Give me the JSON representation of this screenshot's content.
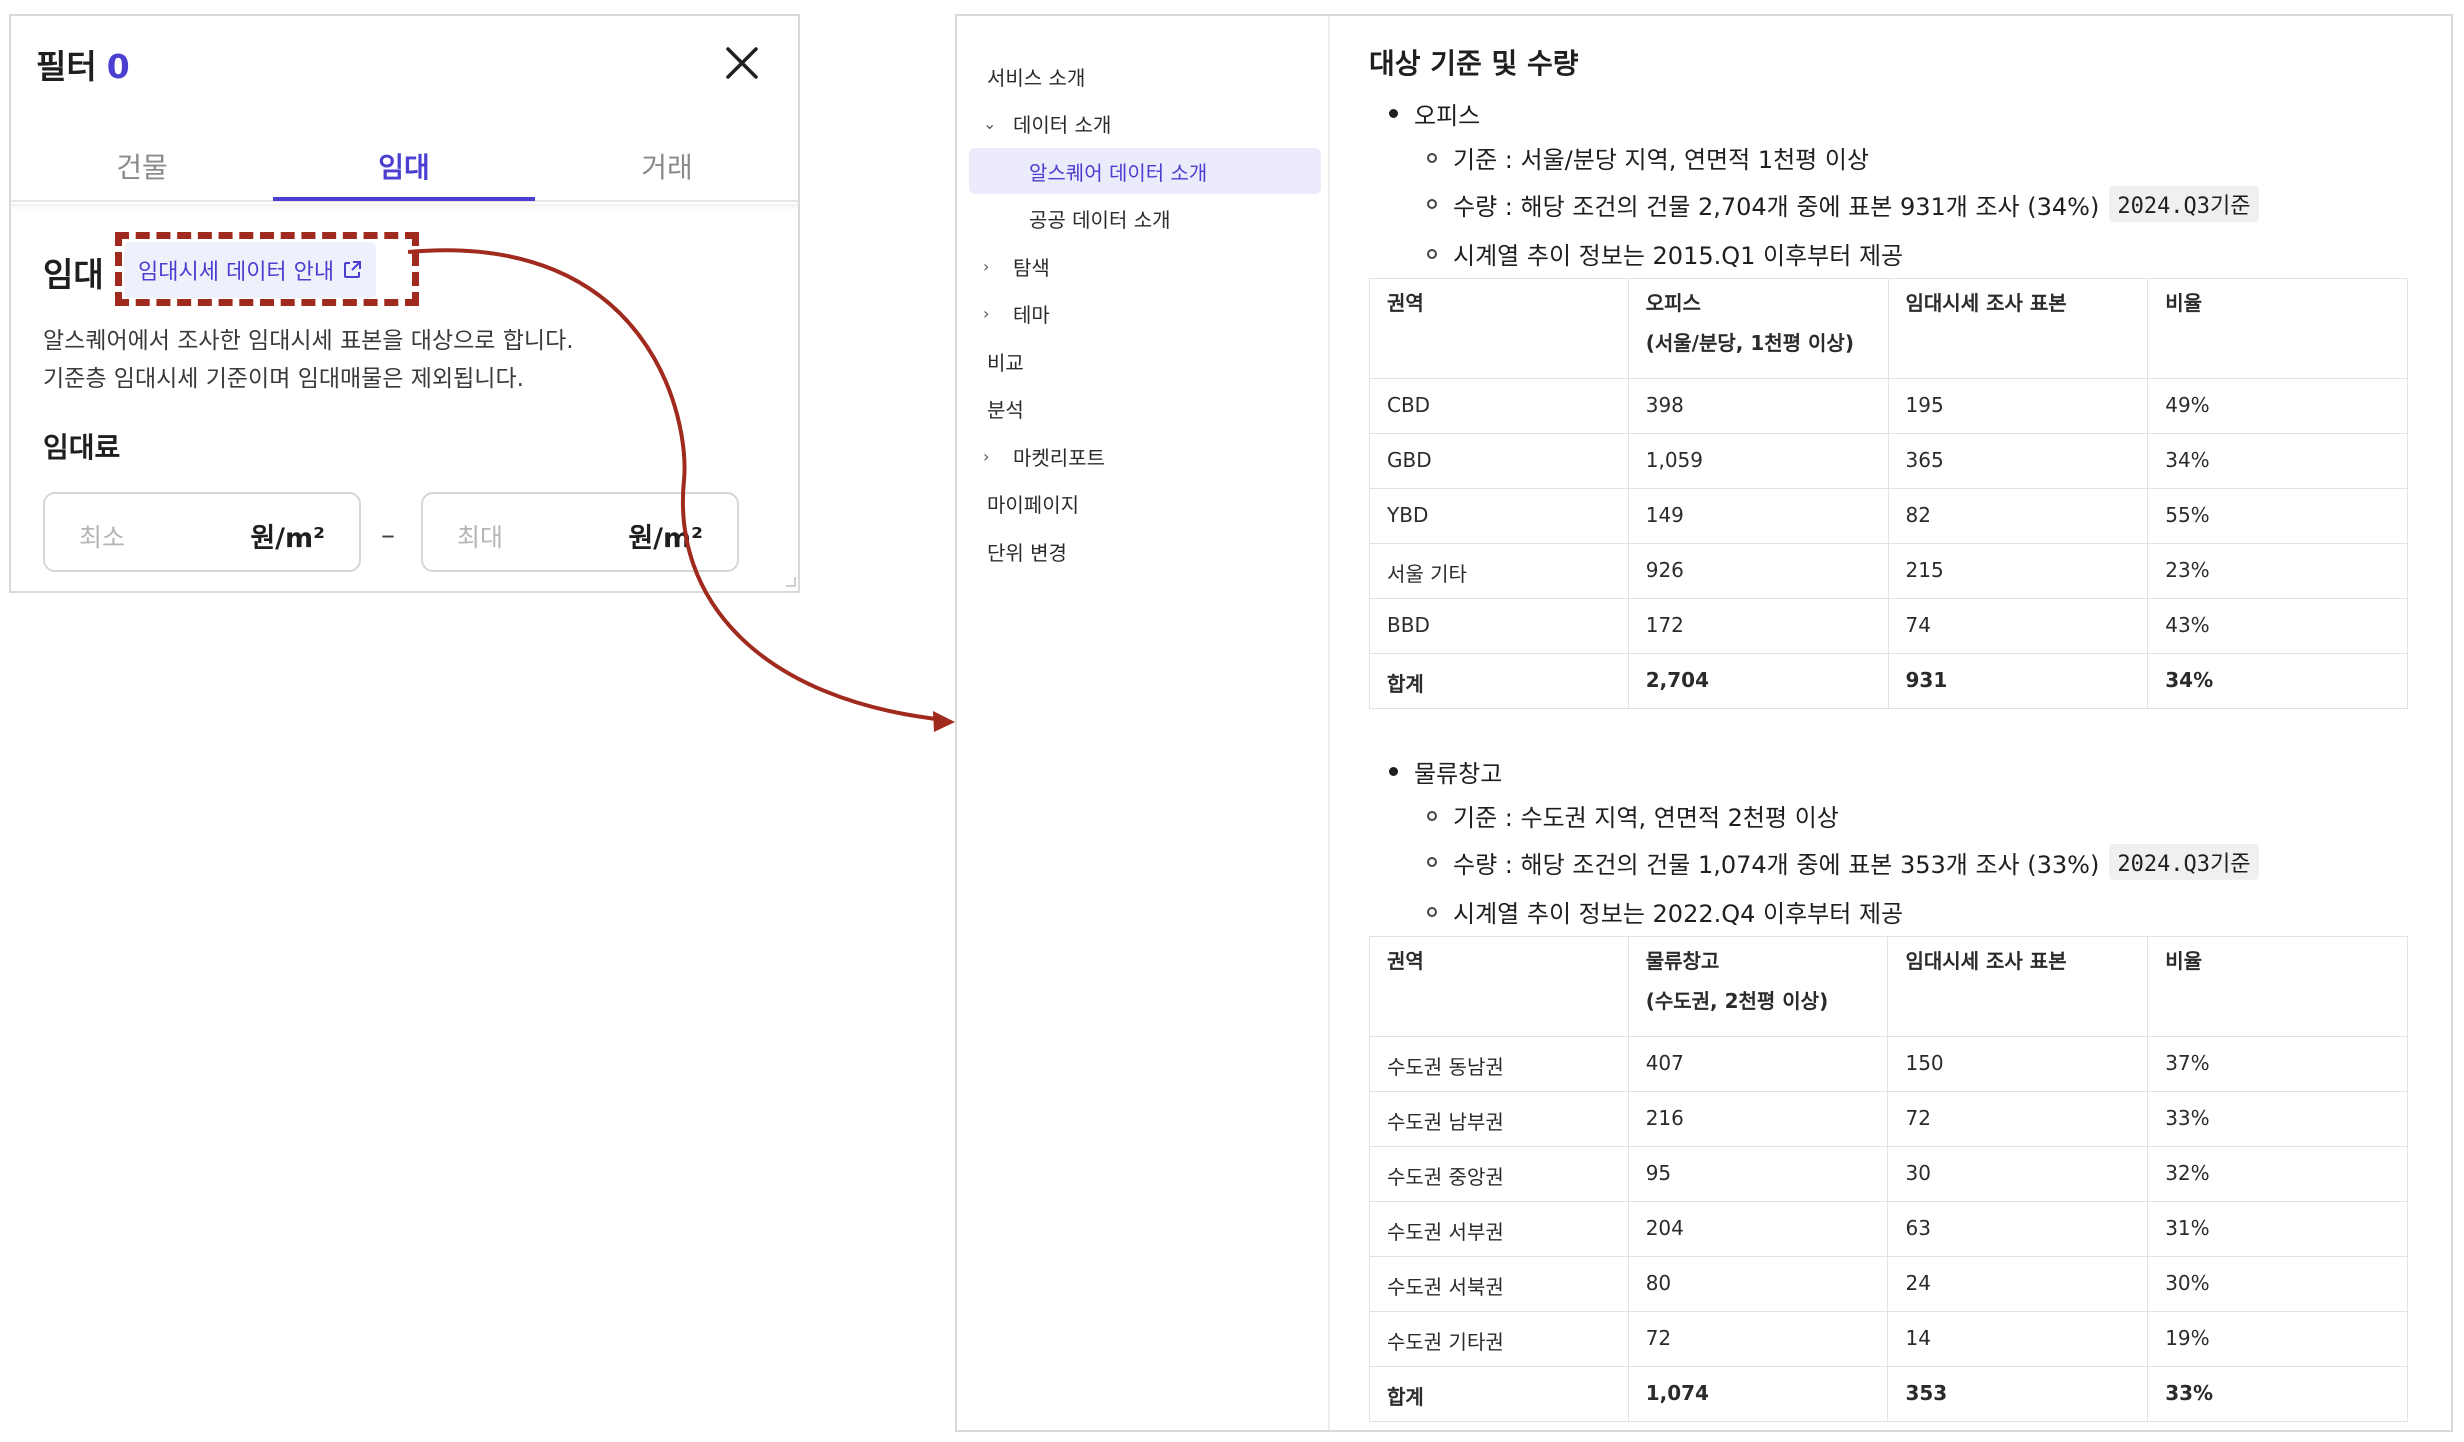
{
  "filter": {
    "title": "필터",
    "count": "0",
    "tabs": [
      "건물",
      "임대",
      "거래"
    ],
    "active_tab": "임대",
    "section_title": "임대",
    "guide_link": "임대시세 데이터 안내",
    "description_line1": "알스퀘어에서 조사한 임대시세 표본을 대상으로 합니다.",
    "description_line2": "기준층 임대시세 기준이며 임대매물은 제외됩니다.",
    "rent_label": "임대료",
    "min_placeholder": "최소",
    "max_placeholder": "최대",
    "unit": "원/m²",
    "range_separator": "–"
  },
  "sidebar": {
    "items": [
      {
        "label": "서비스 소개",
        "level": 0,
        "chevron": "",
        "active": false
      },
      {
        "label": "데이터 소개",
        "level": 0,
        "chevron": "⌄",
        "active": false
      },
      {
        "label": "알스퀘어 데이터 소개",
        "level": 1,
        "chevron": "",
        "active": true
      },
      {
        "label": "공공 데이터 소개",
        "level": 1,
        "chevron": "",
        "active": false
      },
      {
        "label": "탐색",
        "level": 0,
        "chevron": "›",
        "active": false
      },
      {
        "label": "테마",
        "level": 0,
        "chevron": "›",
        "active": false
      },
      {
        "label": "비교",
        "level": 0,
        "chevron": "",
        "active": false
      },
      {
        "label": "분석",
        "level": 0,
        "chevron": "",
        "active": false
      },
      {
        "label": "마켓리포트",
        "level": 0,
        "chevron": "›",
        "active": false
      },
      {
        "label": "마이페이지",
        "level": 0,
        "chevron": "",
        "active": false
      },
      {
        "label": "단위 변경",
        "level": 0,
        "chevron": "",
        "active": false
      }
    ]
  },
  "content": {
    "heading": "대상 기준 및 수량",
    "office": {
      "title": "오피스",
      "criteria": "기준 : 서울/분당 지역, 연면적 1천평 이상",
      "quantity": "수량 : 해당 조건의 건물 2,704개 중에 표본 931개 조사 (34%)",
      "quantity_code": "2024.Q3",
      "quantity_suffix": "기준",
      "timeseries": "시계열 추이 정보는 2015.Q1 이후부터 제공",
      "table": {
        "headers": [
          "권역",
          "오피스\n(서울/분당, 1천평 이상)",
          "임대시세 조사 표본",
          "비율"
        ],
        "rows": [
          [
            "CBD",
            "398",
            "195",
            "49%"
          ],
          [
            "GBD",
            "1,059",
            "365",
            "34%"
          ],
          [
            "YBD",
            "149",
            "82",
            "55%"
          ],
          [
            "서울 기타",
            "926",
            "215",
            "23%"
          ],
          [
            "BBD",
            "172",
            "74",
            "43%"
          ]
        ],
        "total": [
          "합계",
          "2,704",
          "931",
          "34%"
        ]
      }
    },
    "logistics": {
      "title": "물류창고",
      "criteria": "기준 : 수도권 지역, 연면적 2천평 이상",
      "quantity": "수량 : 해당 조건의 건물 1,074개 중에 표본 353개 조사 (33%)",
      "quantity_code": "2024.Q3",
      "quantity_suffix": "기준",
      "timeseries": "시계열 추이 정보는 2022.Q4 이후부터 제공",
      "table": {
        "headers": [
          "권역",
          "물류창고\n(수도권, 2천평 이상)",
          "임대시세 조사 표본",
          "비율"
        ],
        "rows": [
          [
            "수도권 동남권",
            "407",
            "150",
            "37%"
          ],
          [
            "수도권 남부권",
            "216",
            "72",
            "33%"
          ],
          [
            "수도권 중앙권",
            "95",
            "30",
            "32%"
          ],
          [
            "수도권 서부권",
            "204",
            "63",
            "31%"
          ],
          [
            "수도권 서북권",
            "80",
            "24",
            "30%"
          ],
          [
            "수도권 기타권",
            "72",
            "14",
            "19%"
          ]
        ],
        "total": [
          "합계",
          "1,074",
          "353",
          "33%"
        ]
      }
    }
  },
  "colors": {
    "accent": "#4a3fd0",
    "annotation": "#a12a1f",
    "active_bg": "#ebebfb"
  }
}
